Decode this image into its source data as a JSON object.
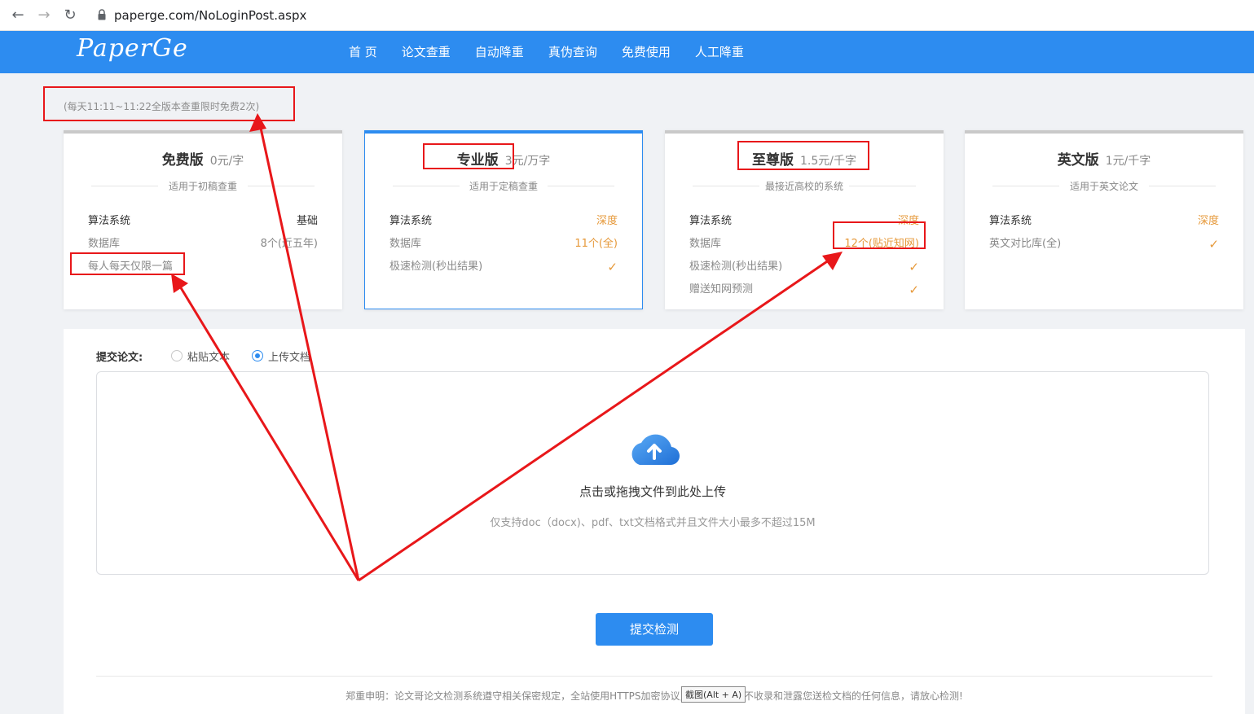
{
  "browser": {
    "url": "paperge.com/NoLoginPost.aspx",
    "back_icon": "←",
    "forward_icon": "→",
    "reload_icon": "↻"
  },
  "site": {
    "logo": "PaperGe",
    "menu": [
      "首 页",
      "论文查重",
      "自动降重",
      "真伪查询",
      "免费使用",
      "人工降重"
    ]
  },
  "promo": "(每天11:11~11:22全版本查重限时免费2次)",
  "cards": [
    {
      "title": "免费版",
      "price": "0元/字",
      "subtitle": "适用于初稿查重",
      "rows": [
        {
          "key": "算法系统",
          "value": "基础"
        },
        {
          "key": "数据库",
          "value": "8个(近五年)"
        },
        {
          "key": "每人每天仅限一篇",
          "value": ""
        }
      ]
    },
    {
      "title": "专业版",
      "price": "3元/万字",
      "subtitle": "适用于定稿查重",
      "rows": [
        {
          "key": "算法系统",
          "value": "深度"
        },
        {
          "key": "数据库",
          "value": "11个(全)"
        },
        {
          "key": "极速检测(秒出结果)",
          "value": "✓"
        }
      ]
    },
    {
      "title": "至尊版",
      "price": "1.5元/千字",
      "subtitle": "最接近高校的系统",
      "rows": [
        {
          "key": "算法系统",
          "value": "深度"
        },
        {
          "key": "数据库",
          "value": "12个(贴近知网)"
        },
        {
          "key": "极速检测(秒出结果)",
          "value": "✓"
        },
        {
          "key": "赠送知网预测",
          "value": "✓"
        }
      ]
    },
    {
      "title": "英文版",
      "price": "1元/千字",
      "subtitle": "适用于英文论文",
      "rows": [
        {
          "key": "算法系统",
          "value": "深度"
        },
        {
          "key": "英文对比库(全)",
          "value": "✓"
        }
      ]
    }
  ],
  "submit": {
    "label": "提交论文:",
    "option_paste": "粘贴文本",
    "option_upload": "上传文档",
    "selected": "上传文档",
    "drop_title": "点击或拖拽文件到此处上传",
    "drop_hint": "仅支持doc（docx)、pdf、txt文档格式并且文件大小最多不超过15M",
    "button": "提交检测"
  },
  "statement": "郑重申明：论文哥论文检测系统遵守相关保密规定，全站使用HTTPS加密协议,文档...SS，绝不收录和泄露您送检文档的任何信息，请放心检测!",
  "tooltip": "截图(Alt + A)",
  "colors": {
    "brand": "#2d8cf0",
    "accent": "#e6993a",
    "annotation": "#e8171a"
  }
}
